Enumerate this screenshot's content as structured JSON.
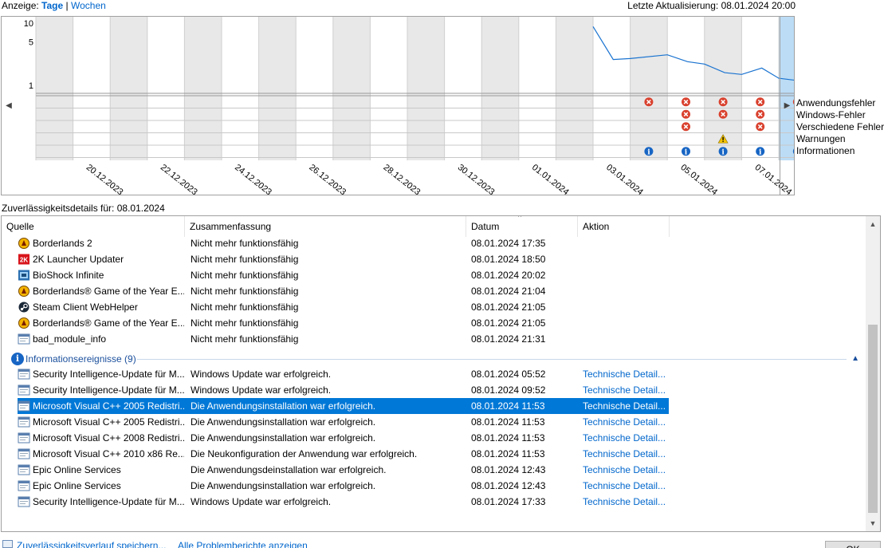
{
  "topbar": {
    "view_prefix": "Anzeige:",
    "view_days": "Tage",
    "view_separator": "|",
    "view_weeks": "Wochen",
    "last_update": "Letzte Aktualisierung: 08.01.2024 20:00"
  },
  "chart_data": {
    "type": "line",
    "title": "",
    "y_ticks": [
      "10",
      "5",
      "1"
    ],
    "ylim": [
      1,
      10
    ],
    "x_labels": [
      "20.12.2023",
      "22.12.2023",
      "24.12.2023",
      "26.12.2023",
      "28.12.2023",
      "30.12.2023",
      "01.01.2024",
      "03.01.2024",
      "05.01.2024",
      "07.01.2024"
    ],
    "days": [
      "19.12.2023",
      "20.12.2023",
      "21.12.2023",
      "22.12.2023",
      "23.12.2023",
      "24.12.2023",
      "25.12.2023",
      "26.12.2023",
      "27.12.2023",
      "28.12.2023",
      "29.12.2023",
      "30.12.2023",
      "31.12.2023",
      "01.01.2024",
      "02.01.2024",
      "03.01.2024",
      "04.01.2024",
      "05.01.2024",
      "06.01.2024",
      "07.01.2024",
      "08.01.2024"
    ],
    "selected_day": "08.01.2024",
    "stability_index": {
      "x": [
        "03.01.2024",
        "03.01.2024",
        "04.01.2024",
        "05.01.2024",
        "05.01.2024",
        "06.01.2024",
        "06.01.2024",
        "07.01.2024",
        "07.01.2024",
        "08.01.2024",
        "08.01.2024"
      ],
      "y": [
        8.8,
        2.6,
        2.7,
        3.1,
        2.4,
        2.2,
        1.6,
        1.5,
        1.9,
        1.3,
        1.1
      ]
    },
    "categories": [
      "Anwendungsfehler",
      "Windows-Fehler",
      "Verschiedene Fehler",
      "Warnungen",
      "Informationen"
    ],
    "events": [
      {
        "day": "04.01.2024",
        "category": "Anwendungsfehler",
        "kind": "error"
      },
      {
        "day": "05.01.2024",
        "category": "Anwendungsfehler",
        "kind": "error"
      },
      {
        "day": "06.01.2024",
        "category": "Anwendungsfehler",
        "kind": "error"
      },
      {
        "day": "07.01.2024",
        "category": "Anwendungsfehler",
        "kind": "error"
      },
      {
        "day": "08.01.2024",
        "category": "Anwendungsfehler",
        "kind": "error"
      },
      {
        "day": "05.01.2024",
        "category": "Windows-Fehler",
        "kind": "error"
      },
      {
        "day": "06.01.2024",
        "category": "Windows-Fehler",
        "kind": "error"
      },
      {
        "day": "07.01.2024",
        "category": "Windows-Fehler",
        "kind": "error"
      },
      {
        "day": "05.01.2024",
        "category": "Verschiedene Fehler",
        "kind": "error"
      },
      {
        "day": "07.01.2024",
        "category": "Verschiedene Fehler",
        "kind": "error"
      },
      {
        "day": "06.01.2024",
        "category": "Warnungen",
        "kind": "warning"
      },
      {
        "day": "04.01.2024",
        "category": "Informationen",
        "kind": "info"
      },
      {
        "day": "05.01.2024",
        "category": "Informationen",
        "kind": "info"
      },
      {
        "day": "06.01.2024",
        "category": "Informationen",
        "kind": "info"
      },
      {
        "day": "07.01.2024",
        "category": "Informationen",
        "kind": "info"
      },
      {
        "day": "08.01.2024",
        "category": "Informationen",
        "kind": "info"
      }
    ],
    "colors": {
      "line": "#1a73d0",
      "grey_band": "#e8e8e8",
      "selected": "#bcdcf5",
      "error": "#d9412e",
      "warning": "#f2c200",
      "info": "#1765c4"
    }
  },
  "details_title": "Zuverlässigkeitsdetails für: 08.01.2024",
  "list": {
    "headers": [
      "Quelle",
      "Zusammenfassung",
      "Datum",
      "Aktion"
    ],
    "sort_indicator": "^",
    "rows": [
      {
        "source": "Borderlands 2",
        "summary": "Nicht mehr funktionsfähig",
        "date": "08.01.2024 17:35",
        "action": "",
        "icon": "borderlands-icon"
      },
      {
        "source": "2K Launcher Updater",
        "summary": "Nicht mehr funktionsfähig",
        "date": "08.01.2024 18:50",
        "action": "",
        "icon": "2k-icon"
      },
      {
        "source": "BioShock Infinite",
        "summary": "Nicht mehr funktionsfähig",
        "date": "08.01.2024 20:02",
        "action": "",
        "icon": "bioshock-icon"
      },
      {
        "source": "Borderlands® Game of the Year E...",
        "summary": "Nicht mehr funktionsfähig",
        "date": "08.01.2024 21:04",
        "action": "",
        "icon": "borderlands-icon"
      },
      {
        "source": "Steam Client WebHelper",
        "summary": "Nicht mehr funktionsfähig",
        "date": "08.01.2024 21:05",
        "action": "",
        "icon": "steam-icon"
      },
      {
        "source": "Borderlands® Game of the Year E...",
        "summary": "Nicht mehr funktionsfähig",
        "date": "08.01.2024 21:05",
        "action": "",
        "icon": "borderlands-icon"
      },
      {
        "source": "bad_module_info",
        "summary": "Nicht mehr funktionsfähig",
        "date": "08.01.2024 21:31",
        "action": "",
        "icon": "app-window-icon"
      }
    ],
    "group_label": "Informationsereignisse (9)",
    "info_rows": [
      {
        "source": "Security Intelligence-Update für M...",
        "summary": "Windows Update war erfolgreich.",
        "date": "08.01.2024 05:52",
        "action": "Technische Detail...",
        "icon": "app-window-icon"
      },
      {
        "source": "Security Intelligence-Update für M...",
        "summary": "Windows Update war erfolgreich.",
        "date": "08.01.2024 09:52",
        "action": "Technische Detail...",
        "icon": "app-window-icon"
      },
      {
        "source": "Microsoft Visual C++ 2005 Redistri...",
        "summary": "Die Anwendungsinstallation war erfolgreich.",
        "date": "08.01.2024 11:53",
        "action": "Technische Detail...",
        "icon": "app-window-icon",
        "selected": true
      },
      {
        "source": "Microsoft Visual C++ 2005 Redistri...",
        "summary": "Die Anwendungsinstallation war erfolgreich.",
        "date": "08.01.2024 11:53",
        "action": "Technische Detail...",
        "icon": "app-window-icon"
      },
      {
        "source": "Microsoft Visual C++ 2008 Redistri...",
        "summary": "Die Anwendungsinstallation war erfolgreich.",
        "date": "08.01.2024 11:53",
        "action": "Technische Detail...",
        "icon": "app-window-icon"
      },
      {
        "source": "Microsoft Visual C++ 2010  x86 Re...",
        "summary": "Die Neukonfiguration der Anwendung war erfolgreich.",
        "date": "08.01.2024 11:53",
        "action": "Technische Detail...",
        "icon": "app-window-icon"
      },
      {
        "source": "Epic Online Services",
        "summary": "Die Anwendungsdeinstallation war erfolgreich.",
        "date": "08.01.2024 12:43",
        "action": "Technische Detail...",
        "icon": "app-window-icon"
      },
      {
        "source": "Epic Online Services",
        "summary": "Die Anwendungsinstallation war erfolgreich.",
        "date": "08.01.2024 12:43",
        "action": "Technische Detail...",
        "icon": "app-window-icon"
      },
      {
        "source": "Security Intelligence-Update für M...",
        "summary": "Windows Update war erfolgreich.",
        "date": "08.01.2024 17:33",
        "action": "Technische Detail...",
        "icon": "app-window-icon"
      }
    ]
  },
  "bottom": {
    "save_link": "Zuverlässigkeitsverlauf speichern...",
    "reports_link": "Alle Problemberichte anzeigen",
    "ok_button": "OK"
  }
}
